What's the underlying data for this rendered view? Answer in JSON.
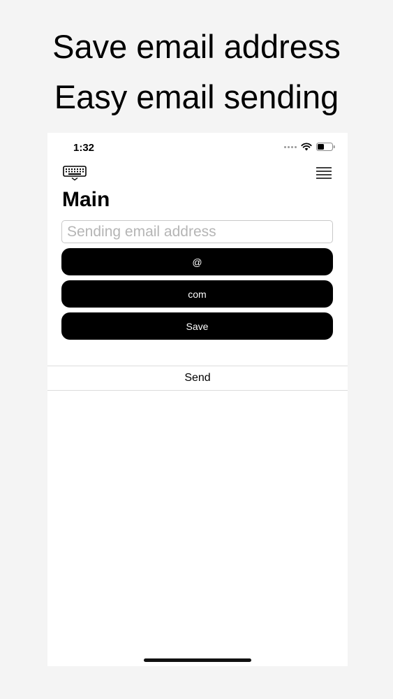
{
  "promo": {
    "line1": "Save email address",
    "line2": "Easy email sending"
  },
  "status_bar": {
    "time": "1:32",
    "icons": [
      "signal-icon",
      "wifi-icon",
      "battery-icon"
    ]
  },
  "nav": {
    "left_icon": "keyboard-icon",
    "right_icon": "menu-icon"
  },
  "main": {
    "title": "Main",
    "email_input": {
      "value": "",
      "placeholder": "Sending email address"
    },
    "buttons": {
      "at_label": "@",
      "com_label": "com",
      "save_label": "Save"
    },
    "send_label": "Send"
  },
  "colors": {
    "background": "#f4f4f4",
    "screen": "#ffffff",
    "button": "#000000",
    "button_text": "#ffffff"
  }
}
